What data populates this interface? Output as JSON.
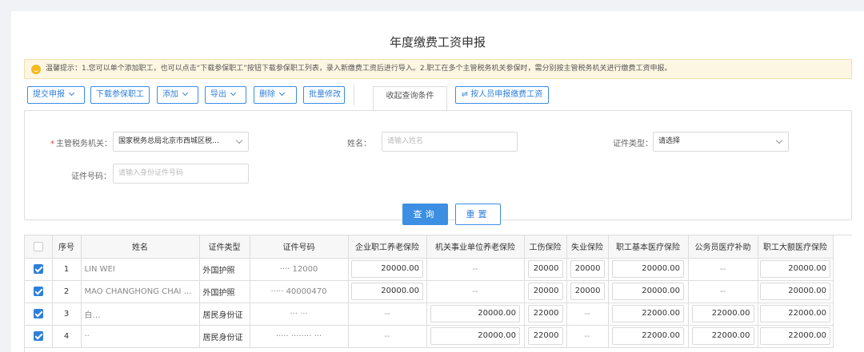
{
  "page": {
    "title": "年度缴费工资申报",
    "tip": "温馨提示：1.您可以单个添加职工，也可以点击“下载参保职工”按钮下载参保职工列表，录入新缴费工资后进行导入。2.职工在多个主管税务机关参保时，需分别按主管税务机关进行缴费工资申报。"
  },
  "toolbar": {
    "submit": "提交申报",
    "download": "下载参保职工",
    "add": "添加",
    "export": "导出",
    "delete": "删除",
    "batch_edit": "批量修改",
    "collapse_tab": "收起查询条件",
    "by_person": "按人员申报缴费工资"
  },
  "query": {
    "tax_authority_label": "主管税务机关：",
    "tax_authority_value": "国家税务总局北京市西城区税…",
    "name_label": "姓名：",
    "name_placeholder": "请输入姓名",
    "id_type_label": "证件类型：",
    "id_type_value": "请选择",
    "id_number_label": "证件号码：",
    "id_number_placeholder": "请输入身份证件号码",
    "search": "查询",
    "reset": "重置"
  },
  "table": {
    "columns": [
      "",
      "序号",
      "姓名",
      "证件类型",
      "证件号码",
      "企业职工养老保险",
      "机关事业单位养老保险",
      "工伤保险",
      "失业保险",
      "职工基本医疗保险",
      "公务员医疗补助",
      "职工大额医疗保险"
    ],
    "rows": [
      {
        "seq": "1",
        "name": "LIN WEI",
        "id_type": "外国护照",
        "id_no": "···· 12000",
        "pension": "20000.00",
        "public_pension": "--",
        "injury": "20000",
        "unemployment": "20000",
        "medical": "20000.00",
        "civil_med": "--",
        "large_med": "20000.00"
      },
      {
        "seq": "2",
        "name": "MAO CHANGHONG CHAI …",
        "id_type": "外国护照",
        "id_no": "····· 40000470",
        "pension": "20000.00",
        "public_pension": "--",
        "injury": "20000",
        "unemployment": "20000",
        "medical": "20000.00",
        "civil_med": "--",
        "large_med": "20000.00"
      },
      {
        "seq": "3",
        "name": "白…",
        "id_type": "居民身份证",
        "id_no": "··· ···",
        "pension": "--",
        "public_pension": "20000.00",
        "injury": "22000",
        "unemployment": "--",
        "medical": "22000.00",
        "civil_med": "22000.00",
        "large_med": "22000.00"
      },
      {
        "seq": "4",
        "name": "··",
        "id_type": "居民身份证",
        "id_no": "····· ········ ···",
        "pension": "--",
        "public_pension": "20000.00",
        "injury": "22000",
        "unemployment": "--",
        "medical": "22000.00",
        "civil_med": "22000.00",
        "large_med": "22000.00"
      }
    ]
  },
  "colors": {
    "primary": "#3c8fe3",
    "tip_bg": "#fdf6e3",
    "tip_icon": "#f5b81e",
    "required": "#e83f3f"
  }
}
